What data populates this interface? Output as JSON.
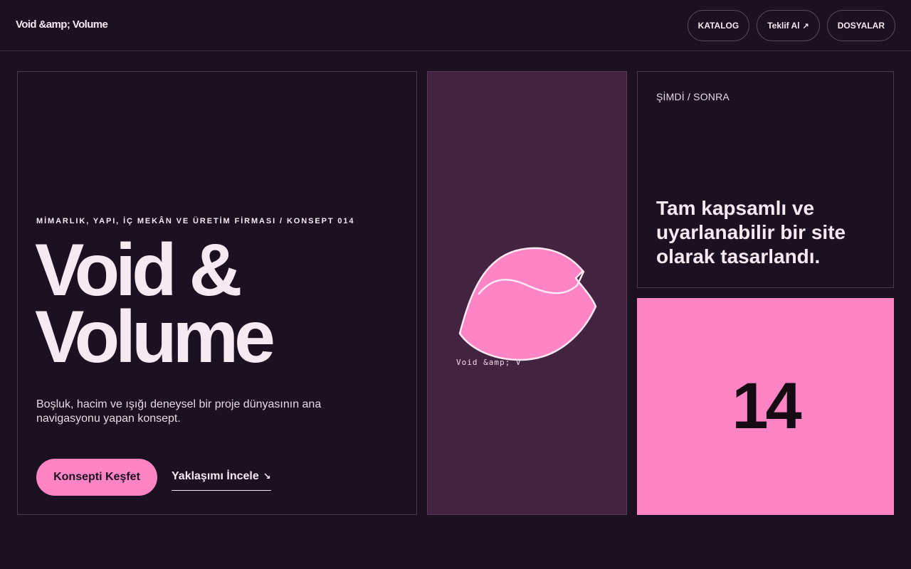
{
  "header": {
    "logo": "Void &amp; Volume",
    "nav": [
      {
        "label": "KATALOG",
        "arrow": ""
      },
      {
        "label": "Teklif Al",
        "arrow": "↗"
      },
      {
        "label": "DOSYALAR",
        "arrow": ""
      }
    ]
  },
  "hero": {
    "eyebrow": "MİMARLIK, YAPI, İÇ MEKÂN VE ÜRETİM FİRMASI / KONSEPT 014",
    "title_line1": "Void &",
    "title_line2": "Volume",
    "description": "Boşluk, hacim ve ışığı deneysel bir proje dünyasının ana navigasyonu yapan konsept.",
    "primary_cta": "Konsepti Keşfet",
    "secondary_cta": "Yaklaşımı İncele",
    "secondary_cta_arrow": "↘"
  },
  "visual": {
    "caption": "Void &amp; V",
    "shape_color": "#ff84c6",
    "background": "#422340"
  },
  "info": {
    "label": "ŞİMDİ / SONRA",
    "text": "Tam kapsamlı ve uyarlanabilir bir site olarak tasarlandı."
  },
  "counter": {
    "value": "14",
    "background": "#ff84c6"
  },
  "colors": {
    "background": "#1c1120",
    "accent": "#ff84c6",
    "text": "#f7e9f1"
  }
}
